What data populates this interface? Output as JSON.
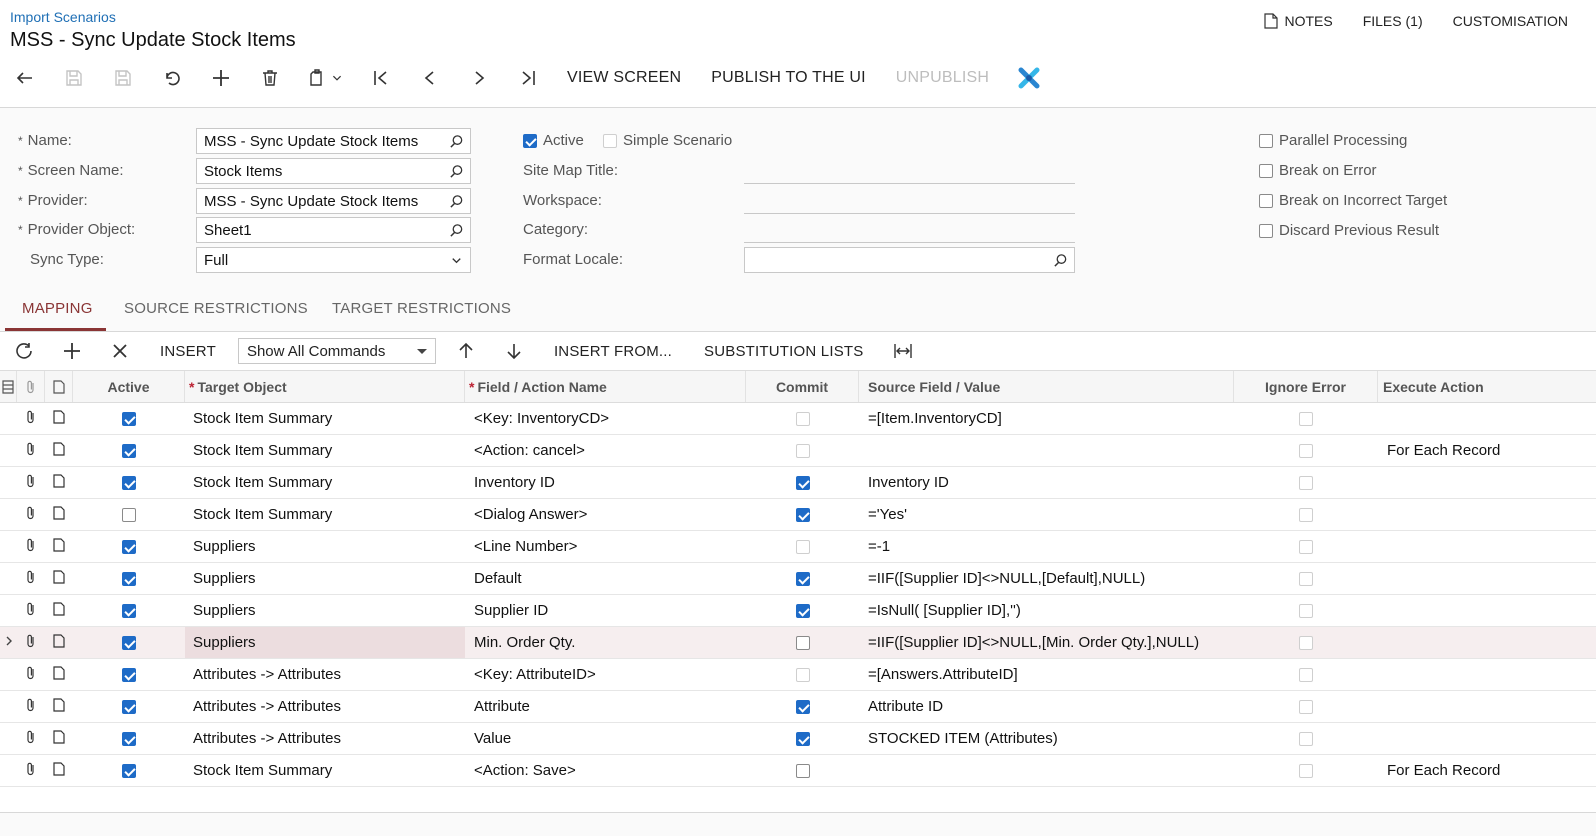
{
  "header": {
    "breadcrumb": "Import Scenarios",
    "title": "MSS - Sync Update Stock Items",
    "links": {
      "notes": "NOTES",
      "files": "FILES (1)",
      "customisation": "CUSTOMISATION"
    }
  },
  "toolbar": {
    "view_screen": "VIEW SCREEN",
    "publish": "PUBLISH TO THE UI",
    "unpublish": "UNPUBLISH"
  },
  "form": {
    "name_label": "Name:",
    "name_value": "MSS - Sync Update Stock Items",
    "screen_label": "Screen Name:",
    "screen_value": "Stock Items",
    "provider_label": "Provider:",
    "provider_value": "MSS - Sync Update Stock Items",
    "provider_object_label": "Provider Object:",
    "provider_object_value": "Sheet1",
    "sync_type_label": "Sync Type:",
    "sync_type_value": "Full",
    "active_label": "Active",
    "simple_label": "Simple Scenario",
    "sitemap_label": "Site Map Title:",
    "workspace_label": "Workspace:",
    "category_label": "Category:",
    "format_locale_label": "Format Locale:",
    "parallel_label": "Parallel Processing",
    "break_error_label": "Break on Error",
    "break_target_label": "Break on Incorrect Target",
    "discard_label": "Discard Previous Result",
    "active": true,
    "simple": false,
    "parallel": false,
    "break_error": false,
    "break_target": false,
    "discard": false
  },
  "tabs": {
    "mapping": "MAPPING",
    "source": "SOURCE RESTRICTIONS",
    "target": "TARGET RESTRICTIONS"
  },
  "grid_toolbar": {
    "insert": "INSERT",
    "commands": "Show All Commands",
    "insert_from": "INSERT FROM...",
    "substitution": "SUBSTITUTION LISTS"
  },
  "grid": {
    "headers": {
      "active": "Active",
      "target_object": "Target Object",
      "field_action": "Field / Action Name",
      "commit": "Commit",
      "source_field": "Source Field / Value",
      "ignore_error": "Ignore Error",
      "execute_action": "Execute Action"
    },
    "rows": [
      {
        "active": true,
        "target": "Stock Item Summary",
        "field": "<Key: InventoryCD>",
        "commit": false,
        "commit_disabled": true,
        "source": "=[Item.InventoryCD]",
        "ignore": false,
        "execute": ""
      },
      {
        "active": true,
        "target": "Stock Item Summary",
        "field": "<Action: cancel>",
        "commit": false,
        "commit_disabled": true,
        "source": "",
        "ignore": false,
        "execute": "For Each Record"
      },
      {
        "active": true,
        "target": "Stock Item Summary",
        "field": "Inventory ID",
        "commit": true,
        "commit_disabled": false,
        "source": "Inventory ID",
        "ignore": false,
        "execute": ""
      },
      {
        "active": false,
        "target": "Stock Item Summary",
        "field": "<Dialog Answer>",
        "commit": true,
        "commit_disabled": false,
        "source": "='Yes'",
        "ignore": false,
        "execute": ""
      },
      {
        "active": true,
        "target": "Suppliers",
        "field": "<Line Number>",
        "commit": false,
        "commit_disabled": true,
        "source": "=-1",
        "ignore": false,
        "execute": ""
      },
      {
        "active": true,
        "target": "Suppliers",
        "field": "Default",
        "commit": true,
        "commit_disabled": false,
        "source": "=IIF([Supplier ID]<>NULL,[Default],NULL)",
        "ignore": false,
        "execute": ""
      },
      {
        "active": true,
        "target": "Suppliers",
        "field": "Supplier ID",
        "commit": true,
        "commit_disabled": false,
        "source": "=IsNull( [Supplier ID],'')",
        "ignore": false,
        "execute": ""
      },
      {
        "active": true,
        "target": "Suppliers",
        "field": "Min. Order Qty.",
        "commit": false,
        "commit_disabled": false,
        "source": "=IIF([Supplier ID]<>NULL,[Min. Order Qty.],NULL)",
        "ignore": false,
        "execute": "",
        "selected": true
      },
      {
        "active": true,
        "target": "Attributes -> Attributes",
        "field": "<Key: AttributeID>",
        "commit": false,
        "commit_disabled": true,
        "source": "=[Answers.AttributeID]",
        "ignore": false,
        "execute": ""
      },
      {
        "active": true,
        "target": "Attributes -> Attributes",
        "field": "Attribute",
        "commit": true,
        "commit_disabled": false,
        "source": "Attribute ID",
        "ignore": false,
        "execute": ""
      },
      {
        "active": true,
        "target": "Attributes -> Attributes",
        "field": "Value",
        "commit": true,
        "commit_disabled": false,
        "source": "STOCKED ITEM (Attributes)",
        "ignore": false,
        "execute": ""
      },
      {
        "active": true,
        "target": "Stock Item Summary",
        "field": "<Action: Save>",
        "commit": false,
        "commit_disabled": false,
        "source": "",
        "ignore": false,
        "execute": "For Each Record"
      }
    ]
  }
}
